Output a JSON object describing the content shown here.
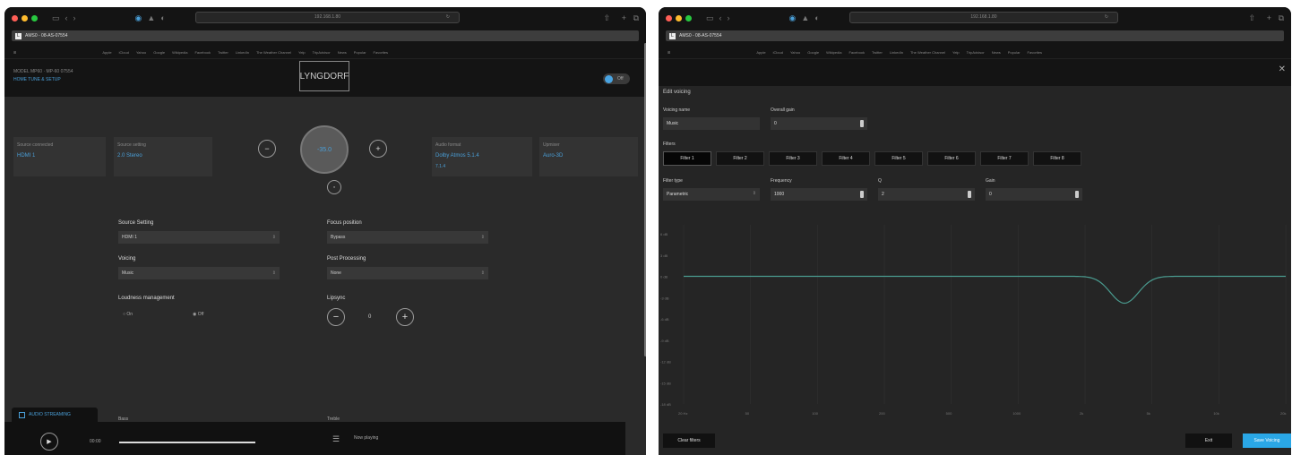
{
  "browser": {
    "url": "192.168.1.80",
    "tab_title": "AMS0 - 08-AS-07554",
    "bookmarks": [
      "Apple",
      "iCloud",
      "Yahoo",
      "Google",
      "Wikipedia",
      "Facebook",
      "Twitter",
      "LinkedIn",
      "The Weather Channel",
      "Yelp",
      "TripAdvisor",
      "News",
      "Popular",
      "Favorites",
      "Reading List",
      "Shared Links",
      "Top Sites",
      "Frequently Visited",
      "Lyngdorf",
      "Audio",
      "Streaming"
    ],
    "traffic_colors": [
      "#ff5f57",
      "#febc2e",
      "#28c840"
    ]
  },
  "device": {
    "model": "MODEL MP60 · MP-60 07554",
    "links": "HOME  TUNE & SETUP"
  },
  "header": {
    "logo": "LYNGDORF",
    "toggle": "Off"
  },
  "cards": [
    {
      "label": "Source connected",
      "value": "HDMI 1"
    },
    {
      "label": "Source setting",
      "value": "2.0 Stereo"
    },
    {
      "label": "Audio format",
      "value": "Dolby Atmos 5.1.4",
      "sub": "7.1.4"
    },
    {
      "label": "Upmixer",
      "value": "Auro-3D"
    }
  ],
  "volume": {
    "value": "-35.0"
  },
  "settings": {
    "source_label": "Source Setting",
    "source_value": "HDMI 1",
    "focus_label": "Focus position",
    "focus_value": "Bypass",
    "voicing_label": "Voicing",
    "voicing_value": "Music",
    "postproc_label": "Post Processing",
    "postproc_value": "None",
    "loudness_label": "Loudness management",
    "loudness_on": "On",
    "loudness_off": "Off",
    "lipsync_label": "Lipsync",
    "lipsync_value": "0"
  },
  "bottom": {
    "left_label": "Bass",
    "right_label": "Treble",
    "streaming": "AUDIO STREAMING",
    "time": "00:00",
    "now_playing": "Now playing"
  },
  "edit": {
    "title": "Edit voicing",
    "voicing_name_label": "Voicing name",
    "voicing_name": "Music",
    "overall_gain_label": "Overall gain",
    "overall_gain": "0",
    "filters_label": "Filters",
    "filters": [
      "Filter 1",
      "Filter 2",
      "Filter 3",
      "Filter 4",
      "Filter 5",
      "Filter 6",
      "Filter 7",
      "Filter 8"
    ],
    "filter_type_label": "Filter type",
    "filter_type": "Parametric",
    "frequency_label": "Frequency",
    "frequency": "1000",
    "q_label": "Q",
    "q": "2",
    "gain_label": "Gain",
    "gain": "0",
    "y_ticks": [
      "6 dB",
      "3 dB",
      "0 dB",
      "-3 dB",
      "-6 dB",
      "-9 dB",
      "-12 dB",
      "-15 dB",
      "-18 dB"
    ],
    "x_ticks": [
      "20 Hz",
      "50",
      "100",
      "200",
      "500",
      "1000",
      "2k",
      "5k",
      "10k",
      "20k"
    ],
    "clear_label": "Clear filters",
    "exit_label": "Exit",
    "save_label": "Save Voicing",
    "accent": "#2aa7e6",
    "curve_color": "#4a9b8f"
  }
}
